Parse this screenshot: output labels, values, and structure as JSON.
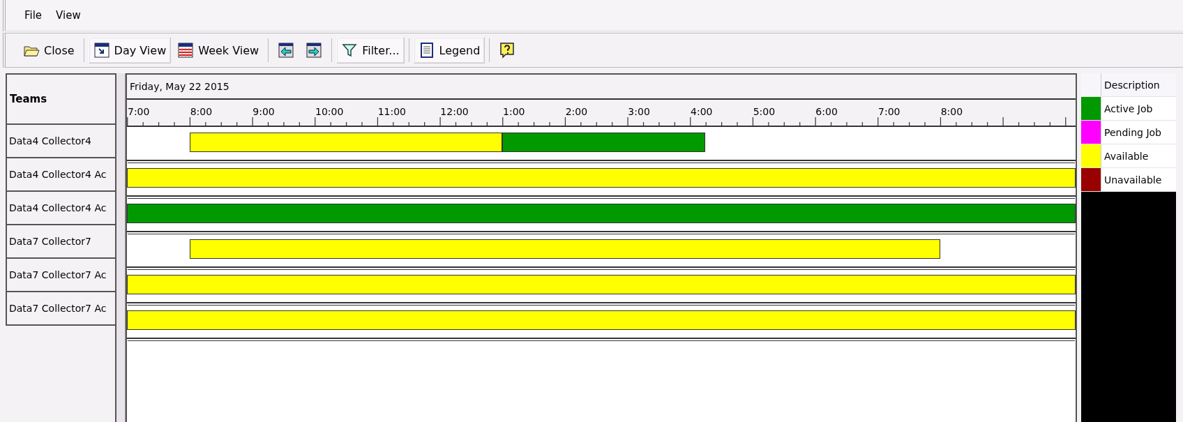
{
  "menu": [
    {
      "label": "File"
    },
    {
      "label": "View"
    }
  ],
  "toolbar": [
    {
      "kind": "close",
      "label": "Close",
      "pressed": false
    },
    {
      "kind": "day",
      "label": "Day View",
      "pressed": true
    },
    {
      "kind": "week",
      "label": "Week View",
      "pressed": false
    },
    {
      "kind": "prev",
      "pressed": false
    },
    {
      "kind": "next",
      "pressed": false
    },
    {
      "kind": "filter",
      "label": "Filter...",
      "pressed": true
    },
    {
      "kind": "legend",
      "label": "Legend",
      "pressed": true
    },
    {
      "kind": "help",
      "pressed": false
    }
  ],
  "teams": {
    "header": "Teams",
    "rows": [
      {
        "name": "Data4 Collector4",
        "segments": [
          {
            "kind": "available"
          },
          {
            "kind": "active"
          }
        ]
      },
      {
        "name": "Data4 Collector4 Ac",
        "segments": [
          {
            "kind": "available"
          }
        ]
      },
      {
        "name": "Data4 Collector4 Ac",
        "segments": [
          {
            "kind": "active"
          }
        ]
      },
      {
        "name": "Data7 Collector7",
        "segments": [
          {
            "kind": "available"
          }
        ]
      },
      {
        "name": "Data7 Collector7 Ac",
        "segments": [
          {
            "kind": "available"
          }
        ]
      },
      {
        "name": "Data7 Collector7 Ac",
        "segments": [
          {
            "kind": "available"
          }
        ]
      }
    ]
  },
  "schedule": {
    "date": "Friday, May 22 2015",
    "hours": [
      "7:00",
      "8:00",
      "9:00",
      "10:00",
      "11:00",
      "12:00",
      "1:00",
      "2:00",
      "3:00",
      "4:00",
      "5:00",
      "6:00",
      "7:00",
      "8:00"
    ]
  },
  "legend": {
    "header": "Description",
    "items": [
      {
        "kind": "active",
        "label": "Active Job",
        "color": "#009900"
      },
      {
        "kind": "pending",
        "label": "Pending Job",
        "color": "#ff00ff"
      },
      {
        "kind": "available",
        "label": "Available",
        "color": "#ffff00"
      },
      {
        "kind": "unavailable",
        "label": "Unavailable",
        "color": "#990000"
      }
    ]
  }
}
